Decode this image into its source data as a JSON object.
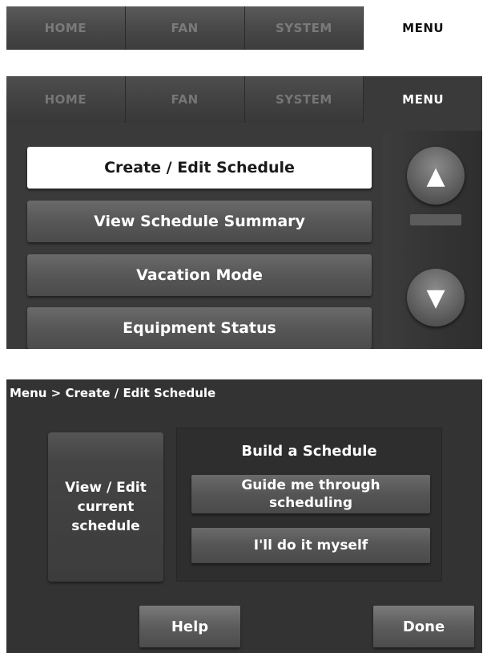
{
  "top_tabs": {
    "home": "HOME",
    "fan": "FAN",
    "system": "SYSTEM",
    "menu": "MENU",
    "active": "menu"
  },
  "menu_screen": {
    "tabs": {
      "home": "HOME",
      "fan": "FAN",
      "system": "SYSTEM",
      "menu": "MENU"
    },
    "items": [
      {
        "label": "Create / Edit Schedule",
        "selected": true
      },
      {
        "label": "View Schedule Summary",
        "selected": false
      },
      {
        "label": "Vacation Mode",
        "selected": false
      },
      {
        "label": "Equipment Status",
        "selected": false
      }
    ],
    "scroll_up_icon": "up-arrow-icon",
    "scroll_down_icon": "down-arrow-icon"
  },
  "schedule_screen": {
    "breadcrumb": "Menu > Create / Edit Schedule",
    "view_edit_label": "View / Edit\ncurrent\nschedule",
    "build_title": "Build a Schedule",
    "guide_label": "Guide me through\nscheduling",
    "myself_label": "I'll do it myself",
    "help_label": "Help",
    "done_label": "Done"
  },
  "colors": {
    "panel_bg": "#3a3a3a",
    "button_gray": "#575757",
    "selected_white": "#ffffff"
  }
}
